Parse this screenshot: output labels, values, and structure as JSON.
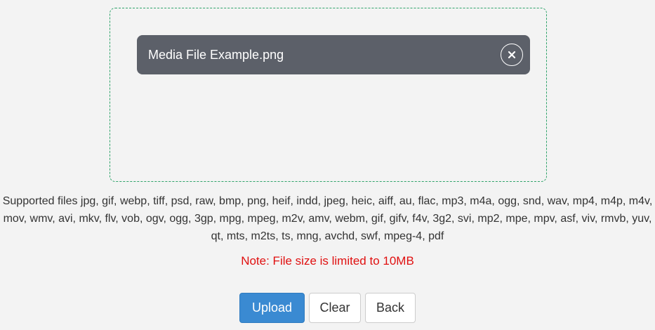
{
  "dropzone": {
    "file": {
      "name": "Media File Example.png",
      "remove_icon": "close-icon"
    }
  },
  "supported_files_text": "Supported files jpg, gif, webp, tiff, psd, raw, bmp, png, heif, indd, jpeg, heic, aiff, au, flac, mp3, m4a, ogg, snd, wav, mp4, m4p, m4v, mov, wmv, avi, mkv, flv, vob, ogv, ogg, 3gp, mpg, mpeg, m2v, amv, webm, gif, gifv, f4v, 3g2, svi, mp2, mpe, mpv, asf, viv, rmvb, yuv, qt, mts, m2ts, ts, mng, avchd, swf, mpeg-4, pdf",
  "note": "Note: File size is limited to 10MB",
  "actions": {
    "upload_label": "Upload",
    "clear_label": "Clear",
    "back_label": "Back"
  },
  "colors": {
    "dropzone_border": "#2fa36a",
    "file_chip_bg": "#5c6069",
    "note_text": "#e01010",
    "primary_button": "#3a8ad2"
  }
}
